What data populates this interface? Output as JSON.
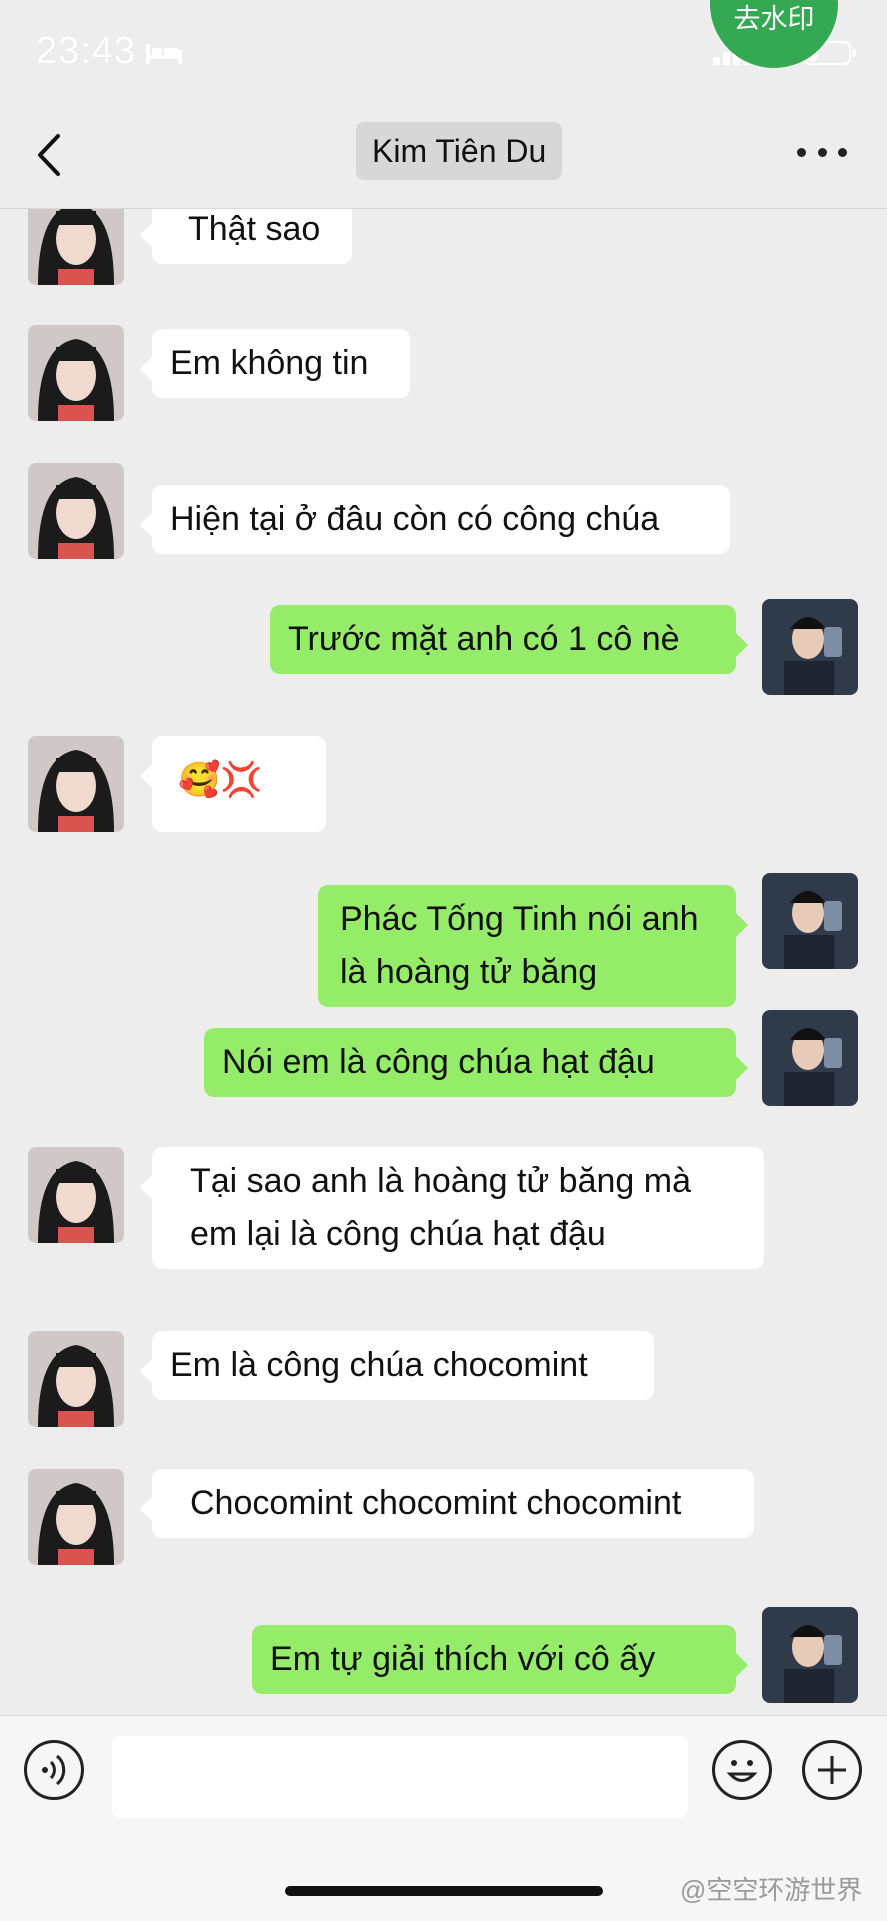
{
  "status_bar": {
    "time": "23:43",
    "watermark_button": "去水印"
  },
  "header": {
    "title": "Kim Tiên Du"
  },
  "messages": [
    {
      "side": "left",
      "text": "Thật sao"
    },
    {
      "side": "left",
      "text": "Em không tin"
    },
    {
      "side": "left",
      "text": "Hiện tại ở đâu còn có công chúa"
    },
    {
      "side": "right",
      "text": "Trước mặt anh có 1 cô nè"
    },
    {
      "side": "left",
      "text": "🥰💢"
    },
    {
      "side": "right",
      "line1": "Phác Tống Tinh nói anh",
      "line2": "là hoàng tử băng"
    },
    {
      "side": "right",
      "text": "Nói em là công chúa hạt đậu"
    },
    {
      "side": "left",
      "line1": "Tại sao anh là hoàng tử băng mà",
      "line2": "em lại là công chúa hạt đậu"
    },
    {
      "side": "left",
      "text": "Em là công chúa chocomint"
    },
    {
      "side": "left",
      "text": "Chocomint chocomint chocomint"
    },
    {
      "side": "right",
      "text": "Em tự giải thích với cô ấy"
    }
  ],
  "footer": {
    "input_value": "",
    "weibo_watermark": "@空空环游世界"
  },
  "colors": {
    "background": "#ededed",
    "sent_bubble": "#95ec69",
    "received_bubble": "#ffffff",
    "watermark_green": "#34a853"
  }
}
